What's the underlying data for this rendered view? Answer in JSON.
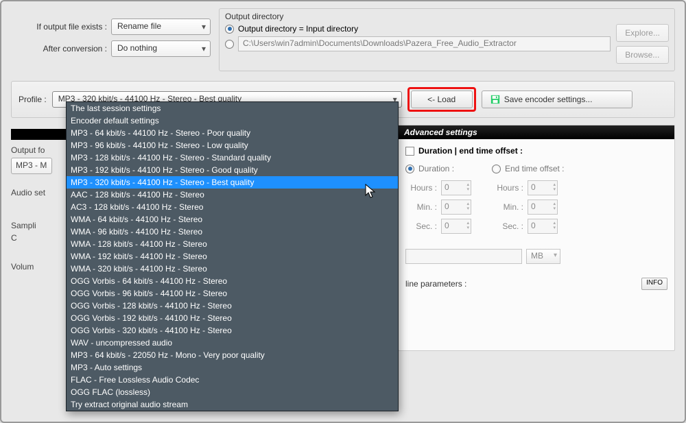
{
  "top": {
    "ifExistsLabel": "If output file exists :",
    "ifExistsValue": "Rename file",
    "afterConvLabel": "After conversion :",
    "afterConvValue": "Do nothing"
  },
  "outputDir": {
    "title": "Output directory",
    "sameAsInput": "Output directory = Input directory",
    "customPath": "C:\\Users\\win7admin\\Documents\\Downloads\\Pazera_Free_Audio_Extractor",
    "explore": "Explore...",
    "browse": "Browse..."
  },
  "profileBar": {
    "label": "Profile :",
    "value": "MP3 - 320 kbit/s - 44100 Hz - Stereo - Best quality",
    "load": "<- Load",
    "save": "Save encoder settings..."
  },
  "leftHidden": {
    "outputFormat": "Output fo",
    "mp3Btn": "MP3 - M",
    "audioSet": "Audio set",
    "sampling": "Sampli",
    "c": "C",
    "volume": "Volum"
  },
  "advanced": {
    "title": "Advanced settings",
    "durationHeader": "Duration | end time offset :",
    "durationRadio": "Duration :",
    "endTimeRadio": "End time offset :",
    "hours": "Hours :",
    "min": "Min. :",
    "sec": "Sec. :",
    "zero": "0",
    "mbUnit": "MB",
    "paramsLabel": "line parameters :",
    "info": "INFO"
  },
  "dropdown": {
    "items": [
      "The last session settings",
      "Encoder default settings",
      "MP3 - 64 kbit/s - 44100 Hz - Stereo - Poor quality",
      "MP3 - 96 kbit/s - 44100 Hz - Stereo - Low quality",
      "MP3 - 128 kbit/s - 44100 Hz - Stereo - Standard quality",
      "MP3 - 192 kbit/s - 44100 Hz - Stereo - Good quality",
      "MP3 - 320 kbit/s - 44100 Hz - Stereo - Best quality",
      "AAC - 128 kbit/s - 44100 Hz - Stereo",
      "AC3 - 128 kbit/s - 44100 Hz - Stereo",
      "WMA - 64 kbit/s - 44100 Hz - Stereo",
      "WMA - 96 kbit/s - 44100 Hz - Stereo",
      "WMA - 128 kbit/s - 44100 Hz - Stereo",
      "WMA - 192 kbit/s - 44100 Hz - Stereo",
      "WMA - 320 kbit/s - 44100 Hz - Stereo",
      "OGG Vorbis - 64 kbit/s - 44100 Hz - Stereo",
      "OGG Vorbis - 96 kbit/s - 44100 Hz - Stereo",
      "OGG Vorbis - 128 kbit/s - 44100 Hz - Stereo",
      "OGG Vorbis - 192 kbit/s - 44100 Hz - Stereo",
      "OGG Vorbis - 320 kbit/s - 44100 Hz - Stereo",
      "WAV - uncompressed audio",
      "MP3 - 64 kbit/s - 22050 Hz - Mono - Very poor quality",
      "MP3 - Auto settings",
      "FLAC - Free Lossless Audio Codec",
      "OGG FLAC (lossless)",
      "Try extract original audio stream"
    ],
    "selectedIndex": 6
  }
}
